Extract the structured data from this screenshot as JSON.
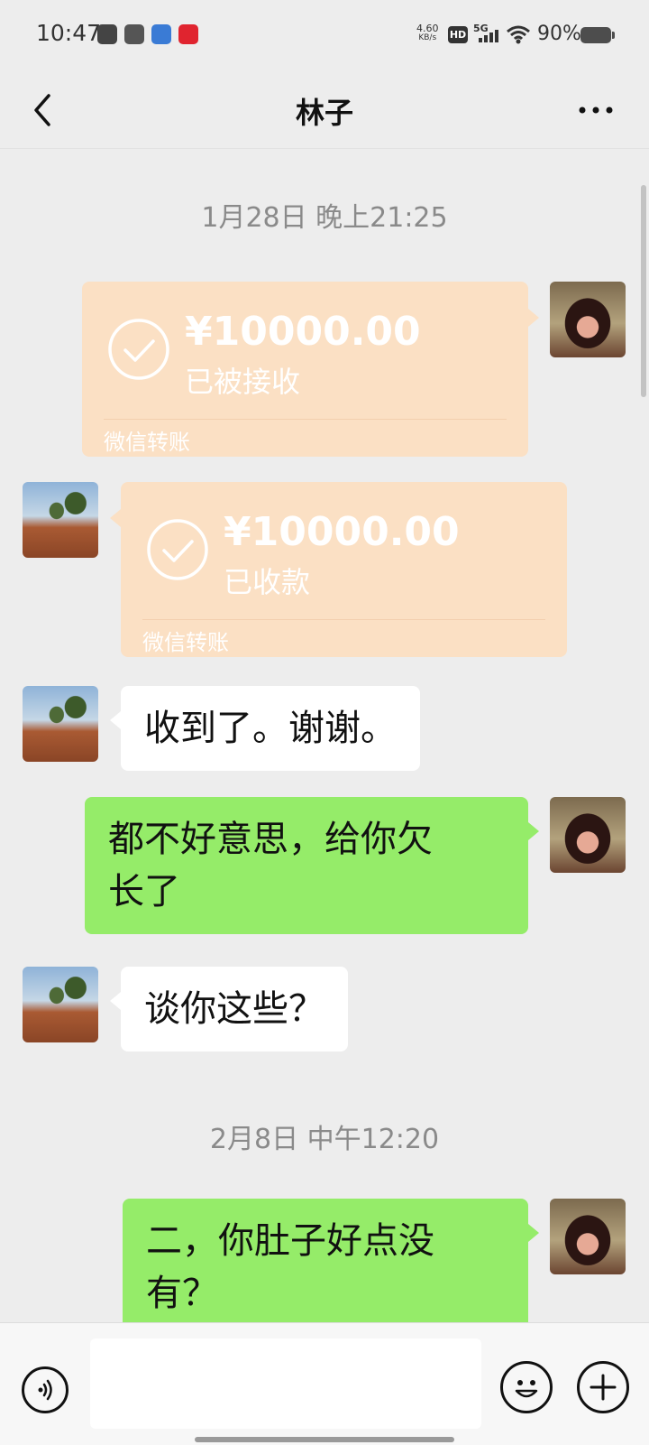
{
  "status_bar": {
    "time": "10:47",
    "speed_value": "4.60",
    "speed_unit": "KB/s",
    "hd": "HD",
    "network": "5G",
    "battery": "90%"
  },
  "nav": {
    "back_icon": "chevron-left-icon",
    "title": "林子",
    "more_icon": "more-icon"
  },
  "messages": {
    "ts1": "1月28日 晚上21:25",
    "transfer1": {
      "amount": "¥10000.00",
      "status": "已被接收",
      "label": "微信转账"
    },
    "transfer2": {
      "amount": "¥10000.00",
      "status": "已收款",
      "label": "微信转账"
    },
    "msg1": "收到了。谢谢。",
    "msg2_line1": "都不好意思，给你欠",
    "msg2_line2": "长了",
    "msg3": "谈你这些？",
    "ts2": "2月8日 中午12:20",
    "msg4_line1": "二，你肚子好点没",
    "msg4_line2": "有？"
  },
  "input_bar": {
    "voice_icon": "voice-icon",
    "emoji_icon": "emoji-icon",
    "plus_icon": "plus-icon",
    "input_value": ""
  },
  "colors": {
    "background": "#ededed",
    "transfer": "#fbe0c4",
    "sent_bubble": "#95ec69",
    "received_bubble": "#ffffff"
  }
}
